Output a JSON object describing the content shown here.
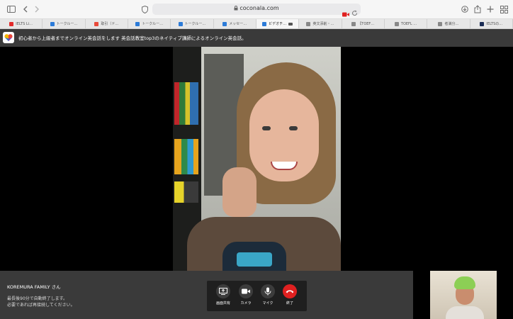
{
  "browser": {
    "url": "coconala.com",
    "tabs": [
      {
        "label": "IELTS Li…",
        "color": "#e22b2b",
        "active": false
      },
      {
        "label": "トークルー…",
        "color": "#2c7bd8",
        "active": false
      },
      {
        "label": "取引（ド…",
        "color": "#e94a3a",
        "active": false
      },
      {
        "label": "トークルー…",
        "color": "#2c7bd8",
        "active": false
      },
      {
        "label": "トークルー…",
        "color": "#2c7bd8",
        "active": false
      },
      {
        "label": "メッセー…",
        "color": "#2c7bd8",
        "active": false
      },
      {
        "label": "ビデオチ…",
        "color": "#2c7bd8",
        "active": true
      },
      {
        "label": "英文添削・…",
        "color": "#888888",
        "active": false
      },
      {
        "label": "【TOEF…",
        "color": "#888888",
        "active": false
      },
      {
        "label": "TOEFL …",
        "color": "#888888",
        "active": false
      },
      {
        "label": "者満分…",
        "color": "#888888",
        "active": false
      },
      {
        "label": "IELTSの…",
        "color": "#1b2c55",
        "active": false
      }
    ]
  },
  "header": {
    "title": "初心者から上級者までオンライン英会話をします 英会話教室top3のネイティブ講師によるオンライン英会話。"
  },
  "call": {
    "participant_name": "KOREMURA FAMILY さん",
    "info_line1": "最長後90分で自動終了します。",
    "info_line2": "必要であれば再接続してください。",
    "controls": [
      {
        "id": "screen-share",
        "label": "画面共有",
        "icon": "screen-share-icon"
      },
      {
        "id": "camera",
        "label": "カメラ",
        "icon": "camera-icon"
      },
      {
        "id": "mic",
        "label": "マイク",
        "icon": "microphone-icon"
      },
      {
        "id": "end",
        "label": "終了",
        "icon": "phone-hangup-icon"
      }
    ]
  },
  "colors": {
    "end_call": "#e02020",
    "header_bg": "#3a3a3a"
  }
}
